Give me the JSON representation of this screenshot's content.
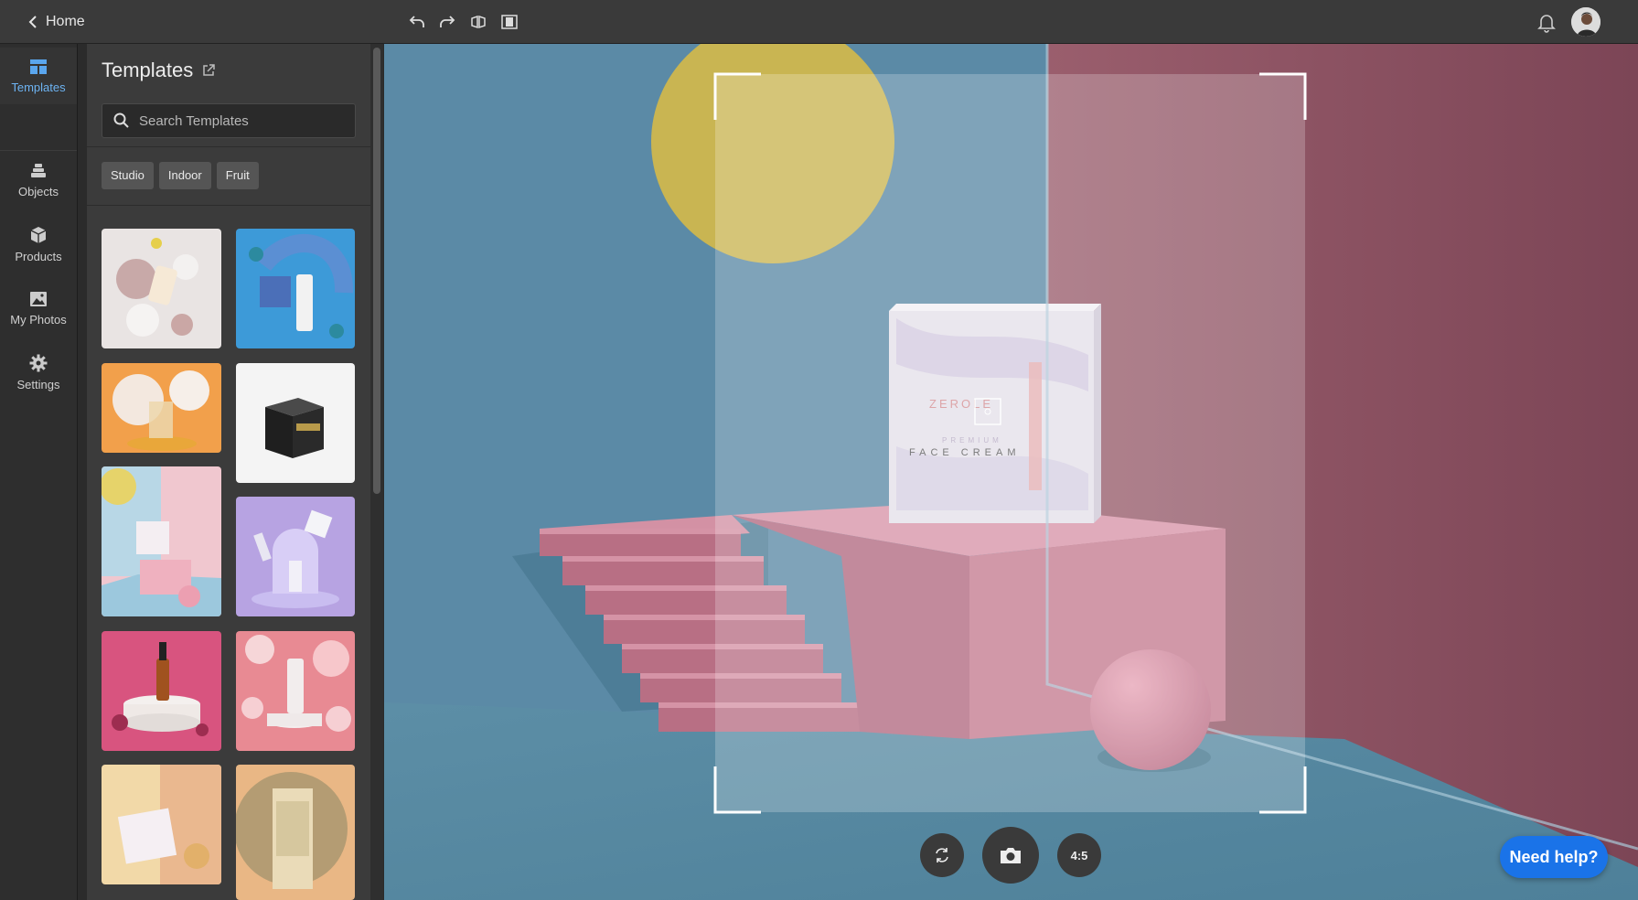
{
  "topbar": {
    "home_label": "Home",
    "tools": [
      "undo-icon",
      "redo-icon",
      "flip-icon",
      "split-view-icon"
    ]
  },
  "rail": {
    "items": [
      {
        "label": "Templates",
        "icon": "templates-icon",
        "active": true
      },
      {
        "label": "Objects",
        "icon": "objects-icon",
        "active": false
      },
      {
        "label": "Products",
        "icon": "products-icon",
        "active": false
      },
      {
        "label": "My Photos",
        "icon": "photos-icon",
        "active": false
      },
      {
        "label": "Settings",
        "icon": "gear-icon",
        "active": false
      }
    ]
  },
  "panel": {
    "title": "Templates",
    "search_placeholder": "Search Templates",
    "chips": [
      "Studio",
      "Indoor",
      "Fruit"
    ]
  },
  "canvas": {
    "product": {
      "brand": "ZEROLE",
      "line": "PREMIUM",
      "name": "FACE CREAM"
    },
    "aspect_label": "4:5"
  },
  "help": {
    "label": "Need help?"
  },
  "colors": {
    "accent": "#5aa6ee",
    "help_button": "#1a73e8",
    "wall_blue": "#6aa6c6",
    "wall_pink": "#8a5566",
    "pink_stairs": "#c77d92",
    "sun_yellow": "#d9c15a"
  }
}
